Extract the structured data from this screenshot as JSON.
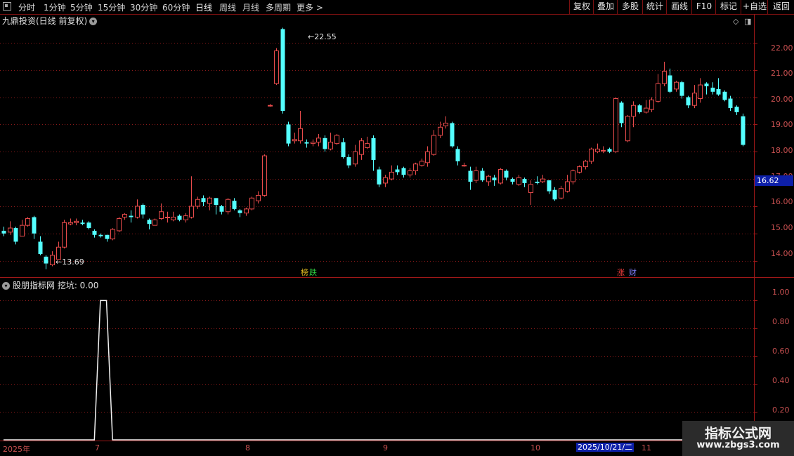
{
  "toolbar": {
    "periods": [
      "分时",
      "1分钟",
      "5分钟",
      "15分钟",
      "30分钟",
      "60分钟",
      "日线",
      "周线",
      "月线",
      "多周期",
      "更多 >"
    ],
    "active_period": "日线",
    "right_buttons": [
      "复权",
      "叠加",
      "多股",
      "统计",
      "画线",
      "F10",
      "标记",
      "+自选",
      "返回"
    ]
  },
  "main_chart": {
    "title": "九鼎投资(日线 前复权)",
    "price_axis": [
      "22.00",
      "21.00",
      "20.00",
      "19.00",
      "18.00",
      "17.00",
      "16.00",
      "15.00",
      "14.00"
    ],
    "current_price": "16.62",
    "high_label": "22.55",
    "low_label": "13.69",
    "event_tags": [
      {
        "text": "榜",
        "color": "#e8c020"
      },
      {
        "text": "跌",
        "color": "#2ecc40"
      },
      {
        "text": "涨",
        "color": "#ff4040"
      },
      {
        "text": "财",
        "color": "#8080ff"
      }
    ]
  },
  "indicator": {
    "title": "股朋指标网 挖坑: 0.00",
    "axis": [
      "1.00",
      "0.80",
      "0.60",
      "0.40",
      "0.20"
    ]
  },
  "date_axis": {
    "labels": [
      "2025年",
      "7",
      "8",
      "9",
      "10",
      "11"
    ],
    "selected_date": "2025/10/21/二"
  },
  "watermark": {
    "main": "指标公式网",
    "url": "www.zbgs3.com"
  },
  "colors": {
    "up": "#e84b4b",
    "down": "#54ffff",
    "grid": "#8b1a1a",
    "axis_text": "#c85050",
    "badge": "#0d1fa8"
  },
  "chart_data": {
    "type": "candlestick",
    "ylim": [
      13.4,
      23.0
    ],
    "candles": [
      [
        15.1,
        15.0,
        15.25,
        14.9
      ],
      [
        15.05,
        15.2,
        15.45,
        14.95
      ],
      [
        15.2,
        14.7,
        15.25,
        14.6
      ],
      [
        14.9,
        15.3,
        15.5,
        14.9
      ],
      [
        15.3,
        15.55,
        15.6,
        15.25
      ],
      [
        15.6,
        15.0,
        15.65,
        14.8
      ],
      [
        14.7,
        14.25,
        14.9,
        14.2
      ],
      [
        14.15,
        13.9,
        14.2,
        13.69
      ],
      [
        13.85,
        14.2,
        14.35,
        13.8
      ],
      [
        14.05,
        14.5,
        14.7,
        14.05
      ],
      [
        14.5,
        15.4,
        15.5,
        14.45
      ],
      [
        15.35,
        15.4,
        15.55,
        15.3
      ],
      [
        15.4,
        15.45,
        15.55,
        15.3
      ],
      [
        15.4,
        15.35,
        15.5,
        15.3
      ],
      [
        15.4,
        15.2,
        15.45,
        15.15
      ],
      [
        15.1,
        14.95,
        15.15,
        14.85
      ],
      [
        14.95,
        14.9,
        15.0,
        14.85
      ],
      [
        14.95,
        14.8,
        14.95,
        14.7
      ],
      [
        14.8,
        15.15,
        15.2,
        14.75
      ],
      [
        15.1,
        15.55,
        15.6,
        15.05
      ],
      [
        15.6,
        15.7,
        15.75,
        15.5
      ],
      [
        15.65,
        15.6,
        15.85,
        15.4
      ],
      [
        15.6,
        16.0,
        16.25,
        15.55
      ],
      [
        16.05,
        15.7,
        16.1,
        15.55
      ],
      [
        15.5,
        15.35,
        15.55,
        15.15
      ],
      [
        15.3,
        15.5,
        15.55,
        15.3
      ],
      [
        15.55,
        15.8,
        16.1,
        15.5
      ],
      [
        15.6,
        15.6,
        15.8,
        15.4
      ],
      [
        15.5,
        15.6,
        15.8,
        15.45
      ],
      [
        15.65,
        15.5,
        15.7,
        15.45
      ],
      [
        15.5,
        15.65,
        15.75,
        15.4
      ],
      [
        15.6,
        16.0,
        17.1,
        15.55
      ],
      [
        16.0,
        16.25,
        16.35,
        15.9
      ],
      [
        16.3,
        16.15,
        16.4,
        16.0
      ],
      [
        16.1,
        16.3,
        16.35,
        15.85
      ],
      [
        16.3,
        16.05,
        16.3,
        15.7
      ],
      [
        16.0,
        15.8,
        16.05,
        15.7
      ],
      [
        15.8,
        16.25,
        16.3,
        15.7
      ],
      [
        16.2,
        15.9,
        16.3,
        15.85
      ],
      [
        15.85,
        15.75,
        15.9,
        15.6
      ],
      [
        15.75,
        15.9,
        15.95,
        15.65
      ],
      [
        15.9,
        16.3,
        16.35,
        15.85
      ],
      [
        16.2,
        16.4,
        16.55,
        16.1
      ],
      [
        16.4,
        17.85,
        17.9,
        16.35
      ],
      [
        19.7,
        19.7,
        19.75,
        19.65
      ],
      [
        20.5,
        21.7,
        21.8,
        20.45
      ],
      [
        22.5,
        19.5,
        22.55,
        19.4
      ],
      [
        19.0,
        18.3,
        19.1,
        18.2
      ],
      [
        18.4,
        18.45,
        18.7,
        18.3
      ],
      [
        18.4,
        18.85,
        19.5,
        18.3
      ],
      [
        18.35,
        18.3,
        18.45,
        18.15
      ],
      [
        18.3,
        18.35,
        18.45,
        18.2
      ],
      [
        18.35,
        18.5,
        18.65,
        18.2
      ],
      [
        18.5,
        18.1,
        18.6,
        18.0
      ],
      [
        18.1,
        18.35,
        18.7,
        18.05
      ],
      [
        18.3,
        18.6,
        18.65,
        18.25
      ],
      [
        18.35,
        17.8,
        18.5,
        17.75
      ],
      [
        17.8,
        17.5,
        17.9,
        17.4
      ],
      [
        17.55,
        18.0,
        18.25,
        17.45
      ],
      [
        17.9,
        18.4,
        18.5,
        17.7
      ],
      [
        18.15,
        18.3,
        18.55,
        18.1
      ],
      [
        18.5,
        17.7,
        18.6,
        17.3
      ],
      [
        17.35,
        16.8,
        17.45,
        16.7
      ],
      [
        16.85,
        17.05,
        17.15,
        16.7
      ],
      [
        17.0,
        17.25,
        17.5,
        16.95
      ],
      [
        17.35,
        17.25,
        17.5,
        17.15
      ],
      [
        17.4,
        17.15,
        17.45,
        17.05
      ],
      [
        17.15,
        17.3,
        17.4,
        17.05
      ],
      [
        17.3,
        17.55,
        17.6,
        17.15
      ],
      [
        17.5,
        17.65,
        17.75,
        17.45
      ],
      [
        17.6,
        18.0,
        18.2,
        17.45
      ],
      [
        17.9,
        18.6,
        18.8,
        17.85
      ],
      [
        18.6,
        18.9,
        19.1,
        18.5
      ],
      [
        18.95,
        19.05,
        19.3,
        18.85
      ],
      [
        19.05,
        18.2,
        19.1,
        18.15
      ],
      [
        18.1,
        17.65,
        18.2,
        17.5
      ],
      [
        17.5,
        17.5,
        17.6,
        17.45
      ],
      [
        17.3,
        16.9,
        17.45,
        16.6
      ],
      [
        16.95,
        17.3,
        17.45,
        16.85
      ],
      [
        17.3,
        16.95,
        17.4,
        16.9
      ],
      [
        16.9,
        17.1,
        17.15,
        16.75
      ],
      [
        17.05,
        16.95,
        17.15,
        16.75
      ],
      [
        16.85,
        17.35,
        17.4,
        16.8
      ],
      [
        17.3,
        17.05,
        17.35,
        16.95
      ],
      [
        17.0,
        16.9,
        17.05,
        16.8
      ],
      [
        16.8,
        17.05,
        17.15,
        16.75
      ],
      [
        17.0,
        16.85,
        17.05,
        16.7
      ],
      [
        16.5,
        16.8,
        16.95,
        16.05
      ],
      [
        16.9,
        16.85,
        17.1,
        16.8
      ],
      [
        16.9,
        17.0,
        17.15,
        16.85
      ],
      [
        16.95,
        16.55,
        16.95,
        16.45
      ],
      [
        16.6,
        16.25,
        16.7,
        16.2
      ],
      [
        16.3,
        16.65,
        16.75,
        16.25
      ],
      [
        16.55,
        16.9,
        17.15,
        16.5
      ],
      [
        16.9,
        17.3,
        17.35,
        16.8
      ],
      [
        17.25,
        17.45,
        17.5,
        17.2
      ],
      [
        17.45,
        17.65,
        17.7,
        17.35
      ],
      [
        17.65,
        18.1,
        18.15,
        17.55
      ],
      [
        18.0,
        18.1,
        18.3,
        17.95
      ],
      [
        18.05,
        18.05,
        18.2,
        17.95
      ],
      [
        18.1,
        18.0,
        18.15,
        17.95
      ],
      [
        18.0,
        19.95,
        20.0,
        17.95
      ],
      [
        19.8,
        19.05,
        19.85,
        18.9
      ],
      [
        18.4,
        19.3,
        19.35,
        18.35
      ],
      [
        19.3,
        19.7,
        19.85,
        18.9
      ],
      [
        19.7,
        19.45,
        19.75,
        19.4
      ],
      [
        19.45,
        19.6,
        19.9,
        19.4
      ],
      [
        19.55,
        19.9,
        20.0,
        19.45
      ],
      [
        19.85,
        20.5,
        20.85,
        19.8
      ],
      [
        20.5,
        20.95,
        21.3,
        20.4
      ],
      [
        20.8,
        20.2,
        21.05,
        20.15
      ],
      [
        20.3,
        20.55,
        20.6,
        20.2
      ],
      [
        20.55,
        20.05,
        20.6,
        19.95
      ],
      [
        20.0,
        19.7,
        20.05,
        19.6
      ],
      [
        19.7,
        20.15,
        20.45,
        19.6
      ],
      [
        19.95,
        20.45,
        20.7,
        19.8
      ],
      [
        20.5,
        20.4,
        20.55,
        20.1
      ],
      [
        20.35,
        20.2,
        20.55,
        20.1
      ],
      [
        20.3,
        20.1,
        20.7,
        20.05
      ],
      [
        20.2,
        19.9,
        20.25,
        19.85
      ],
      [
        19.95,
        19.6,
        20.05,
        19.5
      ],
      [
        19.65,
        19.45,
        19.7,
        19.35
      ],
      [
        19.3,
        18.25,
        19.4,
        18.2
      ]
    ],
    "indicator_values": [
      0,
      0,
      0,
      0,
      0,
      0,
      0,
      0,
      0,
      0,
      0,
      0,
      0,
      0,
      0,
      0,
      1,
      1,
      0,
      0,
      0,
      0,
      0,
      0,
      0,
      0,
      0,
      0,
      0,
      0,
      0,
      0,
      0,
      0,
      0,
      0,
      0,
      0,
      0,
      0,
      0,
      0,
      0,
      0,
      0,
      0,
      0,
      0,
      0,
      0,
      0,
      0,
      0,
      0,
      0,
      0,
      0,
      0,
      0,
      0,
      0,
      0,
      0,
      0,
      0,
      0,
      0,
      0,
      0,
      0,
      0,
      0,
      0,
      0,
      0,
      0,
      0,
      0,
      0,
      0,
      0,
      0,
      0,
      0,
      0,
      0,
      0,
      0,
      0,
      0,
      0,
      0,
      0,
      0,
      0,
      0,
      0,
      0,
      0,
      0,
      0,
      0,
      0,
      0,
      0,
      0,
      0,
      0,
      0,
      0,
      0,
      0,
      0,
      0,
      0,
      0,
      0,
      0,
      0,
      0,
      0,
      0,
      0
    ],
    "indicator_ylim": [
      0,
      1.05
    ]
  }
}
